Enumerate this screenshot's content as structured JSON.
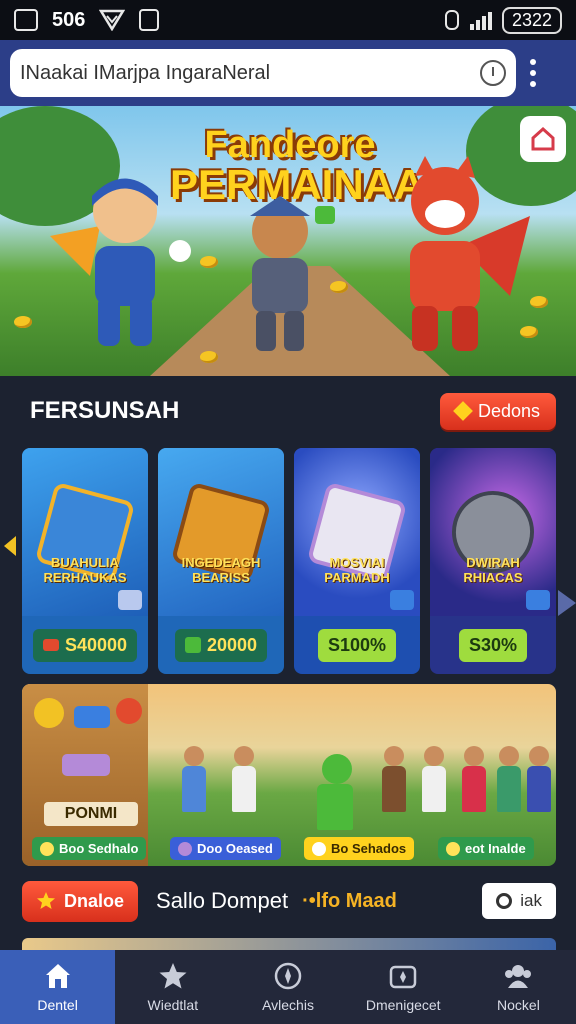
{
  "status_bar": {
    "time": "506",
    "clock": "2322"
  },
  "browser": {
    "url_text": "INaakai IMarjpa IngaraNeral"
  },
  "hero": {
    "title_line1": "Fandeore",
    "title_line2": "PERMAINAA!"
  },
  "section": {
    "title": "FERSUNSAH",
    "action_label": "Dedons"
  },
  "cards": [
    {
      "label": "BUAHULIA RERHAUKAS",
      "price": "S40000",
      "price_style": "dark",
      "bg": "#2c88d8"
    },
    {
      "label": "INGEDEAGH BEARISS",
      "price": "20000",
      "price_style": "dark",
      "bg": "#2f8ee0"
    },
    {
      "label": "MOSVIAI PARMADH",
      "price": "S100%",
      "price_style": "lime",
      "bg": "#2a5fc8"
    },
    {
      "label": "DWIRAH RHIACAS",
      "price": "S30%",
      "price_style": "lime",
      "bg": "#3a2a86"
    }
  ],
  "wide_banner": {
    "left_label": "PONMI",
    "pills": [
      {
        "text": "Boo Sedhalo",
        "bg": "#2f9a4c",
        "color": "#ffffff"
      },
      {
        "text": "Doo Oeased",
        "bg": "#3a5fd8",
        "color": "#ffffff"
      },
      {
        "text": "Bo Sehados",
        "bg": "#ffd21e",
        "color": "#3a2a00"
      },
      {
        "text": "eot Inalde",
        "bg": "#2f9a4c",
        "color": "#ffffff"
      }
    ]
  },
  "wallet": {
    "button_label": "Dnaloe",
    "title": "Sallo Dompet",
    "gold_text": "·•lfo Maad",
    "side_button": "iak"
  },
  "bottom_nav": [
    {
      "label": "Dentel",
      "icon": "home-icon",
      "active": true
    },
    {
      "label": "Wiedtlat",
      "icon": "star-icon",
      "active": false
    },
    {
      "label": "Avlechis",
      "icon": "compass-icon",
      "active": false
    },
    {
      "label": "Dmenigecet",
      "icon": "wallet-icon",
      "active": false
    },
    {
      "label": "Nockel",
      "icon": "people-icon",
      "active": false
    }
  ]
}
